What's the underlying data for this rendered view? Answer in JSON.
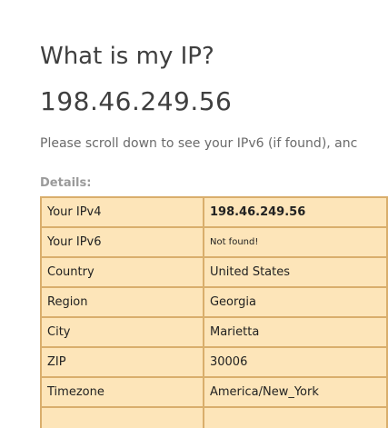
{
  "header": {
    "title": "What is my IP?",
    "ip_address": "198.46.249.56"
  },
  "note": "Please scroll down to see your IPv6 (if found), anc",
  "details": {
    "label": "Details:",
    "rows": [
      {
        "key": "Your IPv4",
        "value": "198.46.249.56"
      },
      {
        "key": "Your IPv6",
        "value": "Not found!"
      },
      {
        "key": "Country",
        "value": "United States"
      },
      {
        "key": "Region",
        "value": "Georgia"
      },
      {
        "key": "City",
        "value": "Marietta"
      },
      {
        "key": "ZIP",
        "value": "30006"
      },
      {
        "key": "Timezone",
        "value": "America/New_York"
      },
      {
        "key": "",
        "value": ""
      }
    ]
  },
  "colors": {
    "table_background": "#fde5b9",
    "table_border": "#d9ae6c",
    "heading_text": "#3f3f3f",
    "muted_text": "#9a9a9a"
  }
}
